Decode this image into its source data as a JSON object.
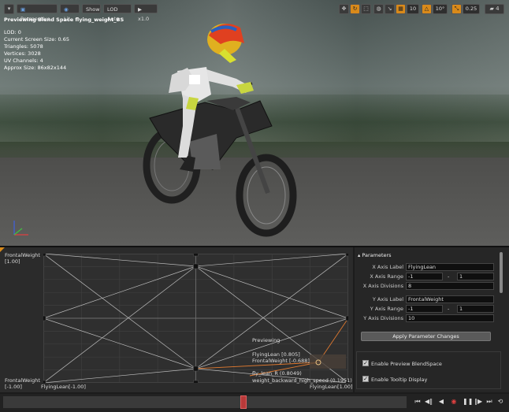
{
  "toolbar": {
    "menu_icon": "▾",
    "perspective_label": "Perspective",
    "lit_label": "Lit",
    "show_label": "Show",
    "lod_label": "LOD Auto",
    "speed_label": "x1.0",
    "grid_snap_value": "10",
    "rotation_snap_value": "10°",
    "scale_snap_value": "0.25",
    "camera_speed_value": "4"
  },
  "viewport": {
    "title": "Previewing Blend Space flying_weight_BS",
    "stats": [
      "LOD: 0",
      "Current Screen Size: 0.65",
      "Triangles: 5078",
      "Vertices: 3028",
      "UV Channels: 4",
      "Approx Size: 86x82x144"
    ]
  },
  "blendspace": {
    "y_max_label": "FrontalWeight",
    "y_max_value": "[1.00]",
    "y_min_label": "FrontalWeight",
    "y_min_value": "[-1.00]",
    "x_min_label": "FlyingLean[-1.00]",
    "x_max_label": "FlyingLean[1.00]",
    "tooltip": {
      "title": "Previewing",
      "x_value": "FlyingLean [0.805]",
      "y_value": "FrontalWeight [-0.688]",
      "sample_1": "fly_lean_R (0.8049)",
      "sample_2": "weight_backward_high_speed (0.1951)"
    }
  },
  "parameters": {
    "header": "Parameters",
    "x_axis_label_caption": "X Axis Label",
    "x_axis_label_value": "FlyingLean",
    "x_axis_range_caption": "X Axis Range",
    "x_range_min": "-1",
    "x_range_max": "1",
    "x_axis_div_caption": "X Axis Divisions",
    "x_axis_div_value": "8",
    "y_axis_label_caption": "Y Axis Label",
    "y_axis_label_value": "FrontalWeight",
    "y_axis_range_caption": "Y Axis Range",
    "y_range_min": "-1",
    "y_range_max": "1",
    "y_axis_div_caption": "Y Axis Divisions",
    "y_axis_div_value": "10",
    "range_dash": "-",
    "apply_label": "Apply Parameter Changes",
    "enable_preview_label": "Enable Preview BlendSpace",
    "enable_tooltip_label": "Enable Tooltip Display"
  },
  "colors": {
    "accent": "#d98a1a",
    "toolbar_active": "#2f6fbf",
    "preview_line": "#e07a30"
  }
}
